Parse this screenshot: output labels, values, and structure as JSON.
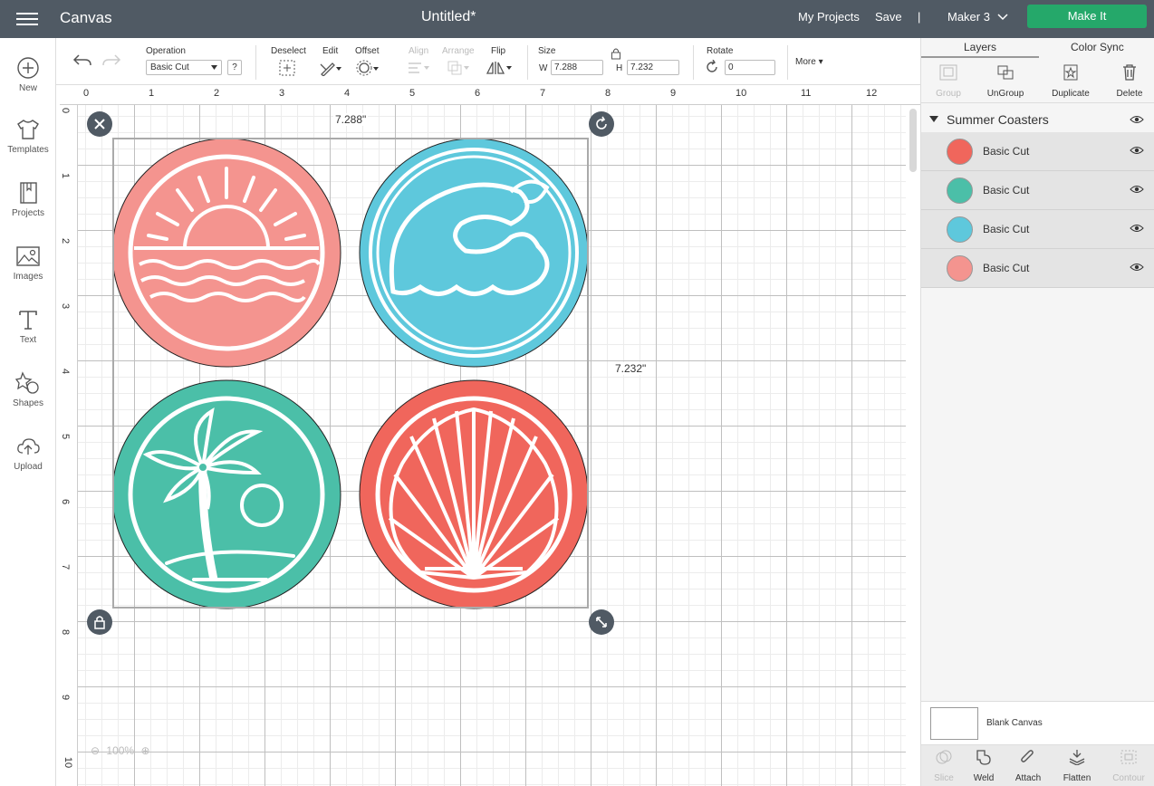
{
  "topbar": {
    "app_title": "Canvas",
    "doc_title": "Untitled*",
    "my_projects": "My Projects",
    "save": "Save",
    "separator": "|",
    "machine": "Maker 3",
    "make_it": "Make It"
  },
  "sidebar": {
    "items": [
      {
        "label": "New",
        "icon": "plus-circle-icon"
      },
      {
        "label": "Templates",
        "icon": "tshirt-icon"
      },
      {
        "label": "Projects",
        "icon": "notebook-icon"
      },
      {
        "label": "Images",
        "icon": "image-icon"
      },
      {
        "label": "Text",
        "icon": "text-icon"
      },
      {
        "label": "Shapes",
        "icon": "shapes-icon"
      },
      {
        "label": "Upload",
        "icon": "cloud-upload-icon"
      }
    ]
  },
  "toolbar": {
    "operation_label": "Operation",
    "operation_value": "Basic Cut",
    "help": "?",
    "deselect": "Deselect",
    "edit": "Edit",
    "offset": "Offset",
    "align": "Align",
    "arrange": "Arrange",
    "flip": "Flip",
    "size_label": "Size",
    "w_label": "W",
    "w_value": "7.288",
    "h_label": "H",
    "h_value": "7.232",
    "rotate_label": "Rotate",
    "rotate_value": "0",
    "more": "More"
  },
  "canvas": {
    "ruler_x": [
      "0",
      "1",
      "2",
      "3",
      "4",
      "5",
      "6",
      "7",
      "8",
      "9",
      "10",
      "11",
      "12"
    ],
    "ruler_y": [
      "0",
      "1",
      "2",
      "3",
      "4",
      "5",
      "6",
      "7",
      "8",
      "9",
      "10"
    ],
    "width_dim": "7.288\"",
    "height_dim": "7.232\"",
    "zoom": "100%",
    "coasters": [
      {
        "name": "sunset",
        "color": "#f4948f"
      },
      {
        "name": "wave",
        "color": "#5ec8dc"
      },
      {
        "name": "palm",
        "color": "#4bbfa8"
      },
      {
        "name": "shell",
        "color": "#f0665c"
      }
    ]
  },
  "panel": {
    "tabs": [
      "Layers",
      "Color Sync"
    ],
    "actions": [
      {
        "label": "Group",
        "enabled": false
      },
      {
        "label": "UnGroup",
        "enabled": true
      },
      {
        "label": "Duplicate",
        "enabled": true
      },
      {
        "label": "Delete",
        "enabled": true
      }
    ],
    "group_name": "Summer Coasters",
    "layers": [
      {
        "label": "Basic Cut",
        "color": "#f0665c"
      },
      {
        "label": "Basic Cut",
        "color": "#4bbfa8"
      },
      {
        "label": "Basic Cut",
        "color": "#5ec8dc"
      },
      {
        "label": "Basic Cut",
        "color": "#f4948f"
      }
    ],
    "blank_canvas": "Blank Canvas",
    "bottom_actions": [
      {
        "label": "Slice",
        "enabled": false
      },
      {
        "label": "Weld",
        "enabled": true
      },
      {
        "label": "Attach",
        "enabled": true
      },
      {
        "label": "Flatten",
        "enabled": true
      },
      {
        "label": "Contour",
        "enabled": false
      }
    ]
  }
}
